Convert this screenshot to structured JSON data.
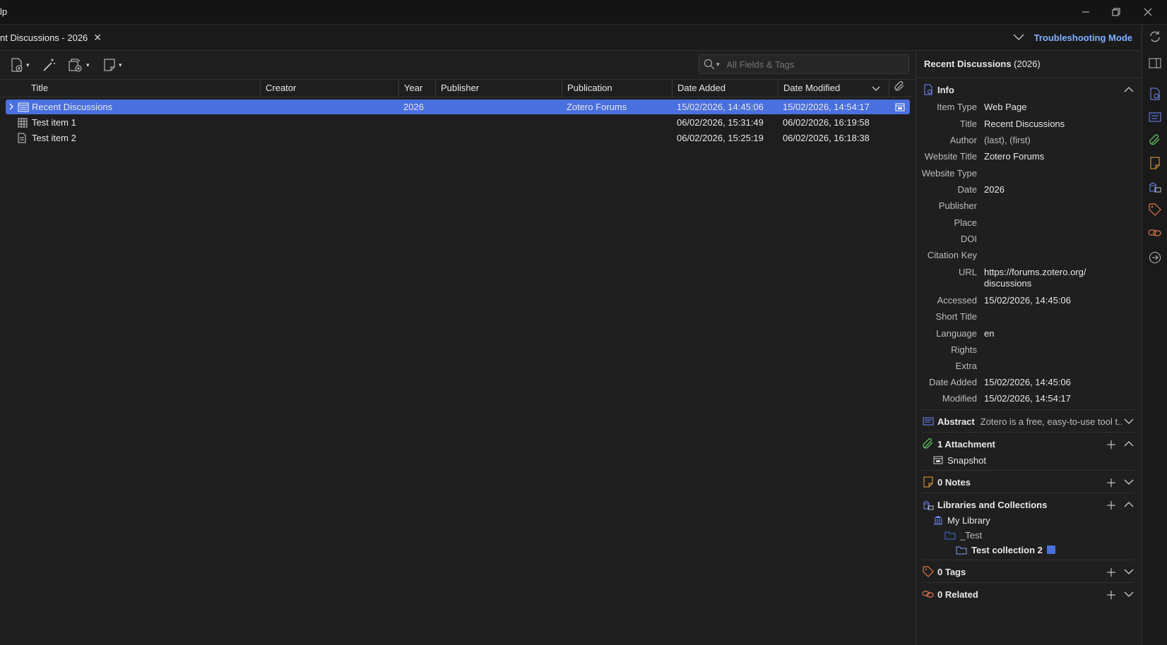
{
  "titlebar": {
    "title": "lp"
  },
  "tab": {
    "label": "nt Discussions - 2026"
  },
  "troubleshooting": {
    "label": "Troubleshooting Mode"
  },
  "search": {
    "placeholder": "All Fields & Tags"
  },
  "columns": {
    "title": "Title",
    "creator": "Creator",
    "year": "Year",
    "publisher": "Publisher",
    "publication": "Publication",
    "date_added": "Date Added",
    "date_modified": "Date Modified"
  },
  "rows": [
    {
      "title": "Recent Discussions",
      "year": "2026",
      "publication": "Zotero Forums",
      "date_added": "15/02/2026, 14:45:06",
      "date_modified": "15/02/2026, 14:54:17"
    },
    {
      "title": "Test item 1",
      "year": "",
      "publication": "",
      "date_added": "06/02/2026, 15:31:49",
      "date_modified": "06/02/2026, 16:19:58"
    },
    {
      "title": "Test item 2",
      "year": "",
      "publication": "",
      "date_added": "06/02/2026, 15:25:19",
      "date_modified": "06/02/2026, 16:18:38"
    }
  ],
  "pane": {
    "title": "Recent Discussions",
    "title_suffix": "(2026)",
    "info_label": "Info",
    "fields": {
      "item_type": {
        "label": "Item Type",
        "value": "Web Page"
      },
      "title": {
        "label": "Title",
        "value": "Recent Discussions"
      },
      "author": {
        "label": "Author",
        "last": "(last),",
        "first": "(first)"
      },
      "website_title": {
        "label": "Website Title",
        "value": "Zotero Forums"
      },
      "website_type": {
        "label": "Website Type",
        "value": ""
      },
      "date": {
        "label": "Date",
        "value": "2026"
      },
      "publisher": {
        "label": "Publisher",
        "value": ""
      },
      "place": {
        "label": "Place",
        "value": ""
      },
      "doi": {
        "label": "DOI",
        "value": ""
      },
      "citation_key": {
        "label": "Citation Key",
        "value": ""
      },
      "url": {
        "label": "URL",
        "line1": "https://forums.zotero.org/",
        "line2": "discussions"
      },
      "accessed": {
        "label": "Accessed",
        "value": "15/02/2026, 14:45:06"
      },
      "short_title": {
        "label": "Short Title",
        "value": ""
      },
      "language": {
        "label": "Language",
        "value": "en"
      },
      "rights": {
        "label": "Rights",
        "value": ""
      },
      "extra": {
        "label": "Extra",
        "value": ""
      },
      "date_added": {
        "label": "Date Added",
        "value": "15/02/2026, 14:45:06"
      },
      "modified": {
        "label": "Modified",
        "value": "15/02/2026, 14:54:17"
      }
    },
    "abstract": {
      "label": "Abstract",
      "preview": "Zotero is a free, easy-to-use tool t..."
    },
    "attachments": {
      "label": "1 Attachment",
      "items": [
        "Snapshot"
      ]
    },
    "notes": {
      "label": "0 Notes"
    },
    "libraries": {
      "label": "Libraries and Collections",
      "library": "My Library",
      "collection": "_Test",
      "subcollection": "Test collection 2"
    },
    "tags": {
      "label": "0 Tags"
    },
    "related": {
      "label": "0 Related"
    }
  },
  "colors": {
    "accent": "#4a6fde",
    "troubleshoot": "#7fb2ff",
    "notes": "#e8a33d",
    "tags": "#e07a4a",
    "related": "#e07a4a",
    "attachment": "#5fbf5f",
    "info": "#6f8cff"
  }
}
